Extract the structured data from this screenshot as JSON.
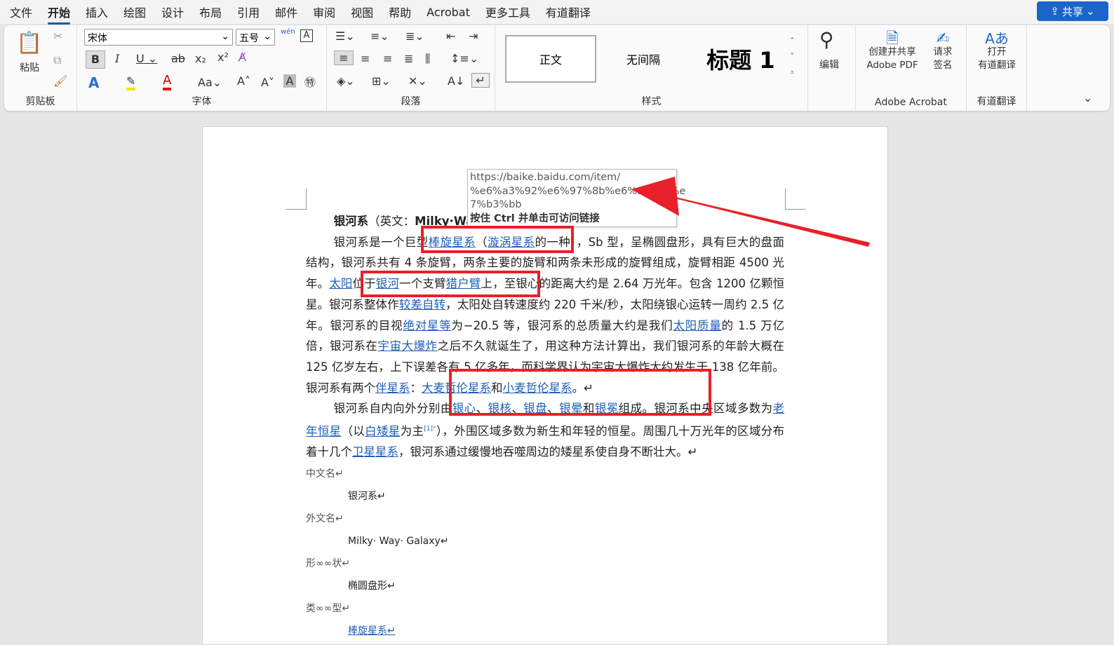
{
  "menu": [
    "文件",
    "开始",
    "插入",
    "绘图",
    "设计",
    "布局",
    "引用",
    "邮件",
    "审阅",
    "视图",
    "帮助",
    "Acrobat",
    "更多工具",
    "有道翻译"
  ],
  "share": "共享",
  "ribbon": {
    "clipboard": {
      "label": "剪贴板",
      "paste": "粘贴"
    },
    "font": {
      "label": "字体",
      "font_name": "宋体",
      "font_size": "五号",
      "pinyin": "wén"
    },
    "paragraph": {
      "label": "段落"
    },
    "styles": {
      "label": "样式",
      "items": [
        "正文",
        "无间隔",
        "标题 1"
      ]
    },
    "edit": {
      "label": "编辑"
    },
    "acrobat": {
      "label": "Adobe Acrobat",
      "create": "创建并共享",
      "create2": "Adobe PDF",
      "sign": "请求",
      "sign2": "签名"
    },
    "youdao": {
      "label": "有道翻译",
      "open": "打开",
      "open2": "有道翻译"
    }
  },
  "tooltip": {
    "url1": "https://baike.baidu.com/item/",
    "url2": "%e6%a3%92%e6%97%8b%e6%98%9f%e",
    "url3": "7%b3%bb",
    "hint": "按住 Ctrl 并单击可访问链接"
  },
  "doc": {
    "paragraphs": [
      [
        {
          "t": "银河系",
          "b": 1
        },
        {
          "t": "（英文："
        },
        {
          "t": "Milky·Way Galaxy",
          "b": 1
        },
        {
          "t": "）"
        }
      ],
      [
        {
          "t": "银河系是一个巨型"
        },
        {
          "t": "棒旋星系",
          "l": 1
        },
        {
          "t": "（"
        },
        {
          "t": "漩涡星系",
          "l": 1
        },
        {
          "t": "的一种），Sb 型，呈椭圆盘形，具有巨大的盘面结构，银河系共有 4 条旋臂，两条主要的旋臂和两条未形成的旋臂组成，旋臂相距 4500 光年。"
        },
        {
          "t": "太阳",
          "l": 1
        },
        {
          "t": "位于"
        },
        {
          "t": "银河",
          "l": 1
        },
        {
          "t": "一个支臂"
        },
        {
          "t": "猎户臂",
          "l": 1
        },
        {
          "t": "上，至银心的距离大约是 2.64 万光年。包含 1200 亿颗恒星。银河系整体作"
        },
        {
          "t": "较差自转",
          "l": 1
        },
        {
          "t": "，太阳处自转速度约 220 千米/秒，太阳绕银心运转一周约 2.5 亿年。银河系的目视"
        },
        {
          "t": "绝对星等",
          "l": 1
        },
        {
          "t": "为−20.5 等，银河系的总质量大约是我们"
        },
        {
          "t": "太阳质量",
          "l": 1
        },
        {
          "t": "的 1.5 万亿倍，银河系在"
        },
        {
          "t": "宇宙大爆炸",
          "l": 1
        },
        {
          "t": "之后不久就诞生了，用这种方法计算出，我们银河系的年龄大概在 125 亿岁左右，上下误差各有 5 亿多年，而科学界认为宇宙大爆炸大约发生于 138 亿年前。银河系有两个"
        },
        {
          "t": "伴星系",
          "l": 1
        },
        {
          "t": "："
        },
        {
          "t": "大麦哲伦星系",
          "l": 1
        },
        {
          "t": "和"
        },
        {
          "t": "小麦哲伦星系",
          "l": 1
        },
        {
          "t": "。↵"
        }
      ],
      [
        {
          "t": "银河系自内向外分别由"
        },
        {
          "t": "银心",
          "l": 1
        },
        {
          "t": "、"
        },
        {
          "t": "银核",
          "l": 1
        },
        {
          "t": "、"
        },
        {
          "t": "银盘",
          "l": 1
        },
        {
          "t": "、"
        },
        {
          "t": "银晕",
          "l": 1
        },
        {
          "t": "和"
        },
        {
          "t": "银冕",
          "l": 1
        },
        {
          "t": "组成。银河系中央区域多数为"
        },
        {
          "t": "老年恒星",
          "l": 1
        },
        {
          "t": "（以"
        },
        {
          "t": "白矮星",
          "l": 1
        },
        {
          "t": "为主"
        },
        {
          "t": "[1]°",
          "sup": 1
        },
        {
          "t": "），外围区域多数为新生和年轻的恒星。周围几十万光年的区域分布着十几个"
        },
        {
          "t": "卫星星系",
          "l": 1
        },
        {
          "t": "，银河系通过缓慢地吞噬周边的矮星系使自身不断壮大。↵"
        }
      ]
    ],
    "info": [
      {
        "k": "中文名↵",
        "v": "银河系↵"
      },
      {
        "k": "外文名↵",
        "v": "Milky· Way· Galaxy↵"
      },
      {
        "k": "形∞∞状↵",
        "v": "椭圆盘形↵"
      },
      {
        "k": "类∞∞型↵",
        "v": "棒旋星系↵",
        "link": true
      }
    ]
  },
  "colors": {
    "accent": "#185abd",
    "annotation": "#e8202a",
    "link": "#1f5fb8"
  }
}
